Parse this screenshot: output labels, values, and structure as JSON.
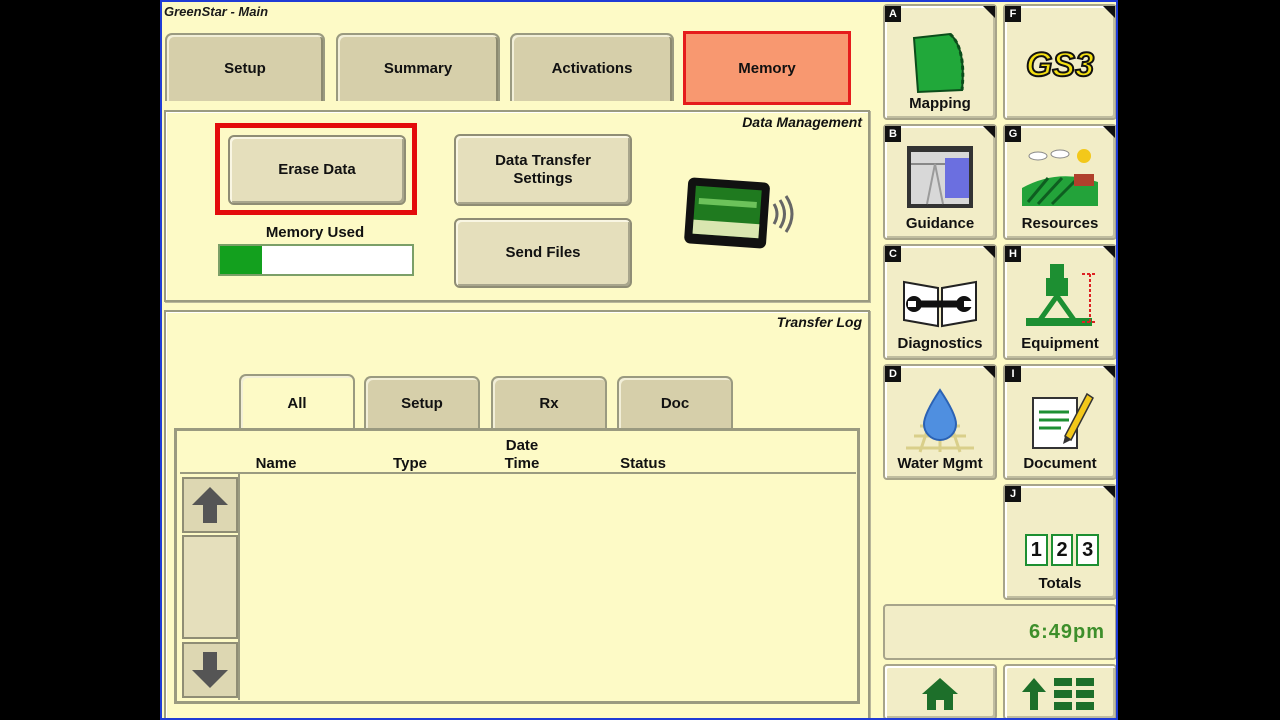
{
  "window": {
    "title": "GreenStar - Main"
  },
  "tabs": [
    {
      "label": "Setup"
    },
    {
      "label": "Summary"
    },
    {
      "label": "Activations"
    },
    {
      "label": "Memory"
    }
  ],
  "data_management": {
    "title": "Data Management",
    "erase_label": "Erase Data",
    "transfer_settings_label": "Data Transfer Settings",
    "send_files_label": "Send Files",
    "memory_used_label": "Memory Used",
    "memory_used_fraction": 0.22
  },
  "transfer_log": {
    "title": "Transfer Log",
    "tabs": [
      {
        "label": "All"
      },
      {
        "label": "Setup"
      },
      {
        "label": "Rx"
      },
      {
        "label": "Doc"
      }
    ],
    "columns": {
      "name": "Name",
      "type": "Type",
      "date": "Date",
      "time": "Time",
      "status": "Status"
    },
    "rows": []
  },
  "side_buttons": [
    {
      "letter": "A",
      "label": "Mapping",
      "icon": "mapping-icon"
    },
    {
      "letter": "F",
      "label": "",
      "icon": "gs3-logo",
      "logo_text": "GS3"
    },
    {
      "letter": "B",
      "label": "Guidance",
      "icon": "guidance-icon"
    },
    {
      "letter": "G",
      "label": "Resources",
      "icon": "resources-icon"
    },
    {
      "letter": "C",
      "label": "Diagnostics",
      "icon": "diagnostics-icon"
    },
    {
      "letter": "H",
      "label": "Equipment",
      "icon": "equipment-icon"
    },
    {
      "letter": "D",
      "label": "Water Mgmt",
      "icon": "water-icon"
    },
    {
      "letter": "I",
      "label": "Document",
      "icon": "document-icon"
    },
    {
      "letter": "J",
      "label": "Totals",
      "icon": "totals-icon",
      "digits": [
        "1",
        "2",
        "3"
      ]
    }
  ],
  "clock": "6:49pm",
  "colors": {
    "background": "#fdfac6",
    "active_tab": "#f89870",
    "highlight": "#e30b0b",
    "memory_fill": "#13a01e",
    "clock_text": "#3e8f2b"
  }
}
